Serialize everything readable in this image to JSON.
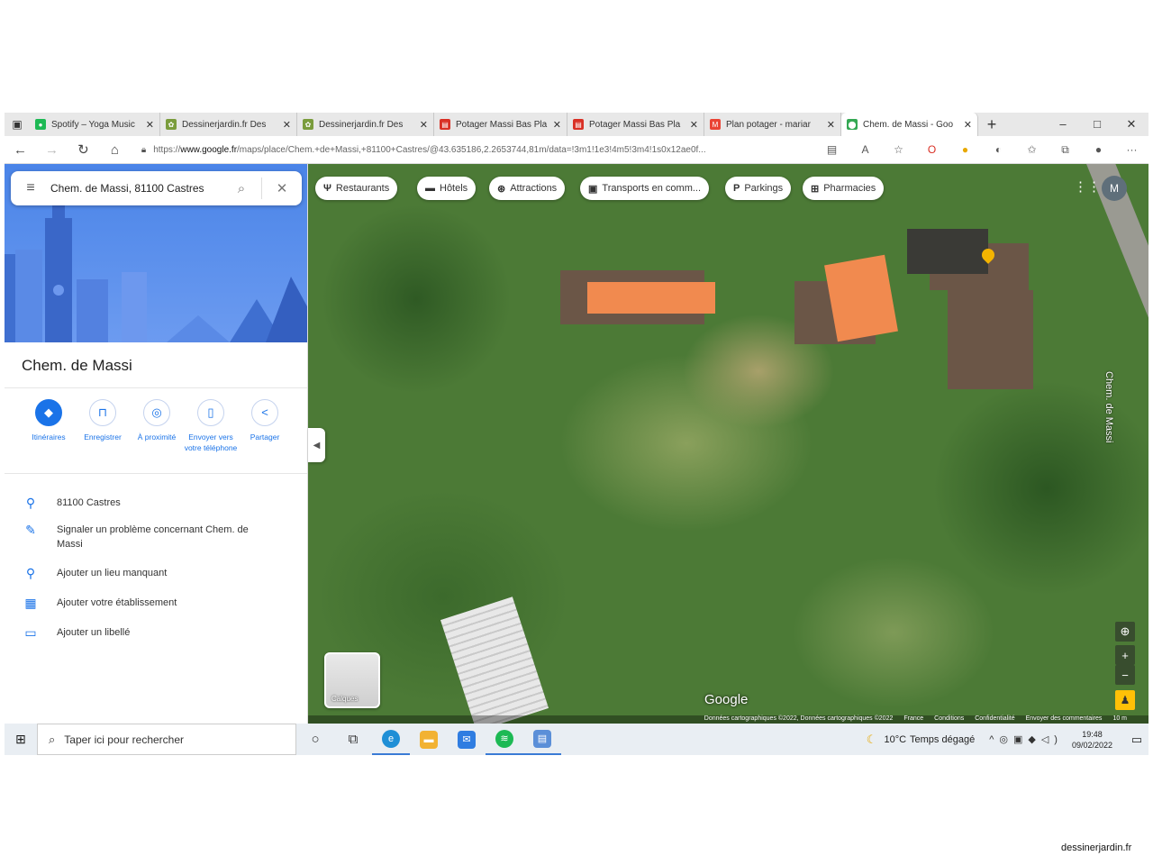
{
  "browser": {
    "tabs": [
      {
        "title": "Spotify – Yoga Music",
        "favicon_color": "#1db954",
        "favicon_glyph": "●",
        "active": false,
        "width": 145
      },
      {
        "title": "Dessinerjardin.fr Des",
        "favicon_color": "#7a9c3c",
        "favicon_glyph": "✿",
        "active": false,
        "width": 152
      },
      {
        "title": "Dessinerjardin.fr Des",
        "favicon_color": "#7a9c3c",
        "favicon_glyph": "✿",
        "active": false,
        "width": 152
      },
      {
        "title": "Potager Massi Bas Pla",
        "favicon_color": "#d93025",
        "favicon_glyph": "▤",
        "active": false,
        "width": 148
      },
      {
        "title": "Potager Massi Bas Pla",
        "favicon_color": "#d93025",
        "favicon_glyph": "▤",
        "active": false,
        "width": 152
      },
      {
        "title": "Plan potager - mariar",
        "favicon_color": "#ea4335",
        "favicon_glyph": "M",
        "active": false,
        "width": 152
      },
      {
        "title": "Chem. de Massi - Goo",
        "favicon_color": "#34a853",
        "favicon_glyph": "⬤",
        "active": true,
        "width": 152
      }
    ],
    "new_tab_label": "+",
    "window_controls": {
      "minimize": "–",
      "maximize": "□",
      "close": "✕"
    },
    "url_prefix": "https://",
    "url_domain": "www.google.fr",
    "url_rest": "/maps/place/Chem.+de+Massi,+81100+Castres/@43.635186,2.2653744,81m/data=!3m1!1e3!4m5!3m4!1s0x12ae0f..."
  },
  "search": {
    "query": "Chem. de Massi, 81100 Castres"
  },
  "place": {
    "title": "Chem. de Massi",
    "actions": [
      {
        "label": "Itinéraires",
        "icon": "directions-icon",
        "glyph": "◆",
        "primary": true
      },
      {
        "label": "Enregistrer",
        "icon": "bookmark-icon",
        "glyph": "⊓",
        "primary": false
      },
      {
        "label": "À proximité",
        "icon": "nearby-icon",
        "glyph": "◎",
        "primary": false
      },
      {
        "label": "Envoyer vers votre téléphone",
        "icon": "phone-icon",
        "glyph": "▯",
        "primary": false
      },
      {
        "label": "Partager",
        "icon": "share-icon",
        "glyph": "<",
        "primary": false
      }
    ],
    "info": [
      {
        "text": "81100 Castres",
        "icon": "location-pin-icon",
        "glyph": "⚲"
      },
      {
        "text": "Signaler un problème concernant Chem. de Massi",
        "icon": "edit-pencil-icon",
        "glyph": "✎"
      },
      {
        "text": "Ajouter un lieu manquant",
        "icon": "add-place-icon",
        "glyph": "⚲"
      },
      {
        "text": "Ajouter votre établissement",
        "icon": "store-icon",
        "glyph": "▦"
      },
      {
        "text": "Ajouter un libellé",
        "icon": "label-icon",
        "glyph": "▭"
      }
    ]
  },
  "map": {
    "chips": [
      {
        "label": "Restaurants",
        "icon": "restaurant-icon",
        "glyph": "Ψ"
      },
      {
        "label": "Hôtels",
        "icon": "hotel-icon",
        "glyph": "▬"
      },
      {
        "label": "Attractions",
        "icon": "attractions-icon",
        "glyph": "⊛"
      },
      {
        "label": "Transports en comm...",
        "icon": "transit-icon",
        "glyph": "▣"
      },
      {
        "label": "Parkings",
        "icon": "parking-icon",
        "glyph": "P"
      },
      {
        "label": "Pharmacies",
        "icon": "pharmacy-icon",
        "glyph": "⊞"
      }
    ],
    "avatar_letter": "M",
    "street_label": "Chem. de Massi",
    "layers_label": "Calques",
    "logo_text": "Google",
    "attribution": [
      "Données cartographiques ©2022, Données cartographiques ©2022",
      "France",
      "Conditions",
      "Confidentialité",
      "Envoyer des commentaires",
      "10 m"
    ],
    "overlay_color": "#f18a4f"
  },
  "taskbar": {
    "search_placeholder": "Taper ici pour rechercher",
    "weather_temp": "10°C",
    "weather_text": "Temps dégagé",
    "time": "19:48",
    "date": "09/02/2022"
  },
  "watermark": "dessinerjardin.fr"
}
